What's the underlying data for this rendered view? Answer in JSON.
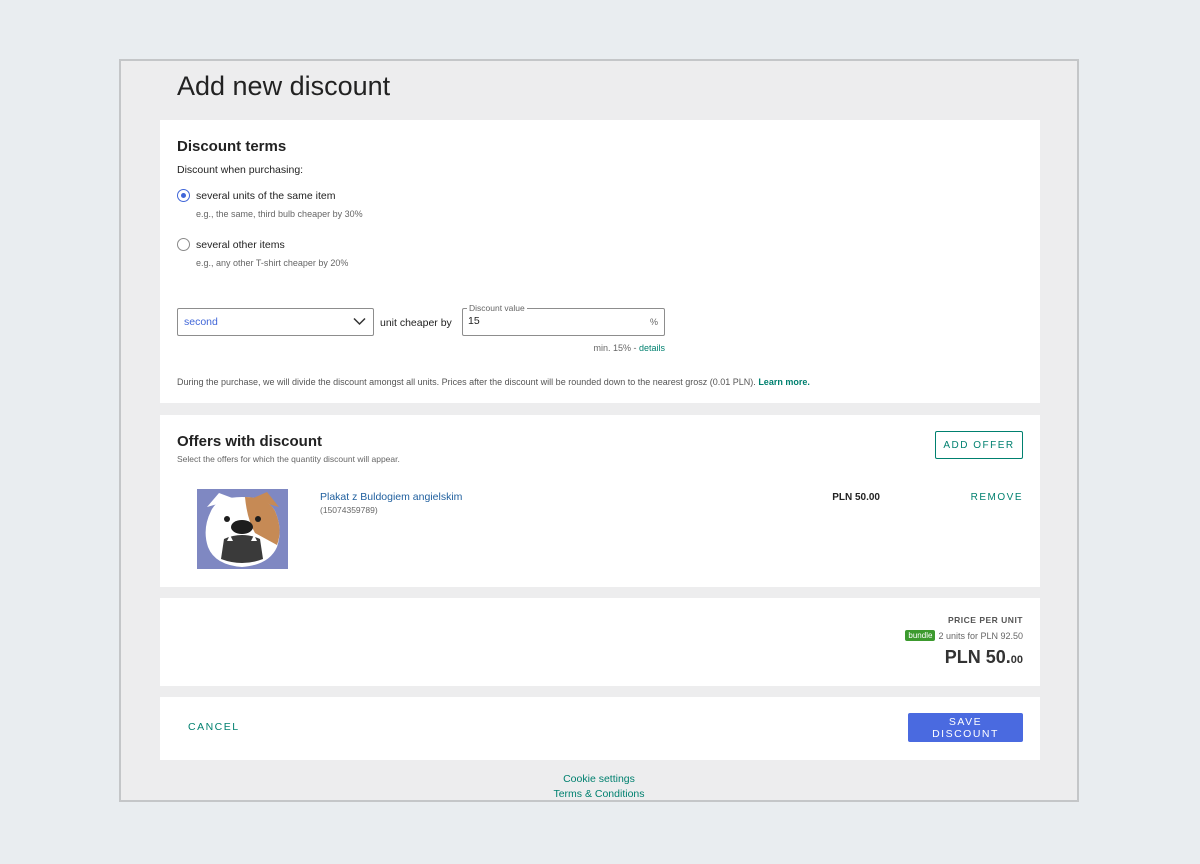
{
  "page": {
    "title": "Add new discount"
  },
  "terms": {
    "heading": "Discount terms",
    "when_label": "Discount when purchasing:",
    "options": [
      {
        "label": "several units of the same item",
        "hint": "e.g., the same, third bulb cheaper by 30%",
        "selected": true
      },
      {
        "label": "several other items",
        "hint": "e.g., any other T-shirt cheaper by 20%",
        "selected": false
      }
    ],
    "unit_select_value": "second",
    "unit_cheaper_text": "unit cheaper by",
    "discount_value_label": "Discount value",
    "discount_value": "15",
    "percent_symbol": "%",
    "min_text": "min. 15% - ",
    "details_link": "details",
    "info_text": "During the purchase, we will divide the discount amongst all units. Prices after the discount will be rounded down to the nearest grosz (0.01 PLN). ",
    "learn_more_link": "Learn more."
  },
  "offers": {
    "heading": "Offers with discount",
    "subtitle": "Select the offers for which the quantity discount will appear.",
    "add_button": "ADD OFFER",
    "items": [
      {
        "name": "Plakat z Buldogiem angielskim",
        "id": "(15074359789)",
        "price": "PLN 50.00",
        "remove_label": "REMOVE"
      }
    ]
  },
  "pricing": {
    "label": "PRICE PER UNIT",
    "bundle_badge": "bundle",
    "bundle_text": "2 units for PLN 92.50",
    "price_main": "PLN 50.",
    "price_cents": "00"
  },
  "actions": {
    "cancel": "CANCEL",
    "save": "SAVE DISCOUNT"
  },
  "footer": {
    "cookie_settings": "Cookie settings",
    "terms": "Terms & Conditions"
  },
  "colors": {
    "accent_blue": "#4066d8",
    "link_teal": "#00806f",
    "bundle_green": "#3c9a2e"
  }
}
